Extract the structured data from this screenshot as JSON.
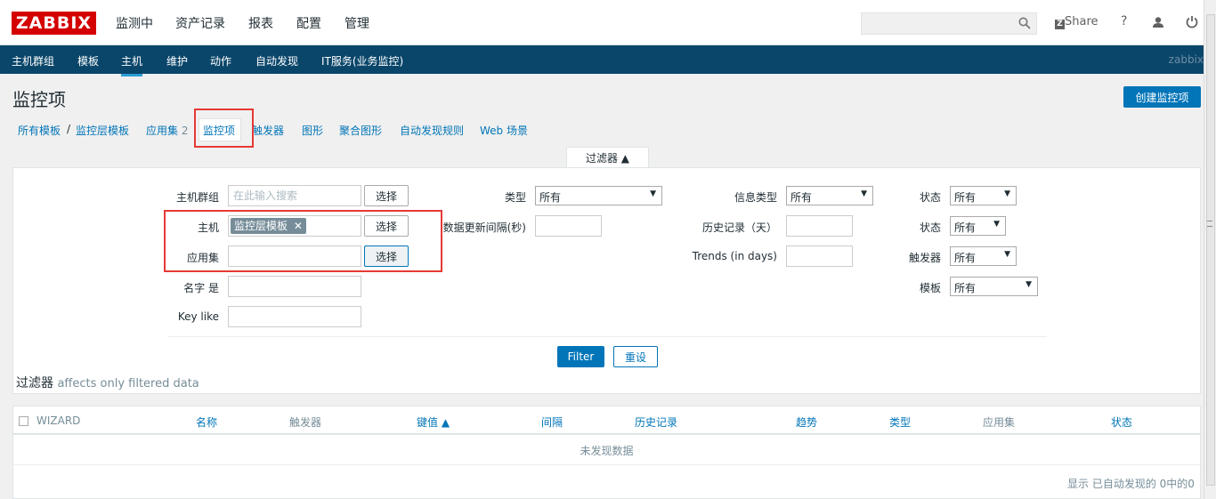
{
  "header": {
    "logo": "ZABBIX",
    "menu": [
      "监测中",
      "资产记录",
      "报表",
      "配置",
      "管理"
    ],
    "search_placeholder": "",
    "share_label": "Share",
    "help_label": "?"
  },
  "subnav": {
    "items": [
      "主机群组",
      "模板",
      "主机",
      "维护",
      "动作",
      "自动发现",
      "IT服务(业务监控)"
    ],
    "right_text": "zabbix"
  },
  "page": {
    "title": "监控项",
    "create_button": "创建监控项"
  },
  "breadcrumbs": {
    "all_templates": "所有模板",
    "separator": "/",
    "template": "监控层模板",
    "apps": "应用集",
    "apps_count": "2",
    "items": "监控项",
    "triggers": "触发器",
    "graphs": "图形",
    "screens": "聚合图形",
    "discovery": "自动发现规则",
    "web": "Web 场景"
  },
  "filter": {
    "tab_label": "过滤器 ▲",
    "host_group_label": "主机群组",
    "host_group_placeholder": "在此输入搜索",
    "select_label": "选择",
    "host_label": "主机",
    "host_tag": "监控层模板",
    "app_label": "应用集",
    "name_label": "名字 是",
    "key_label": "Key like",
    "type_label": "类型",
    "type_value": "所有",
    "interval_label": "数据更新间隔(秒)",
    "info_type_label": "信息类型",
    "info_type_value": "所有",
    "history_label": "历史记录（天）",
    "trends_label": "Trends (in days)",
    "status1_label": "状态",
    "status1_value": "所有",
    "status2_label": "状态",
    "status2_value": "所有",
    "triggers_label": "触发器",
    "triggers_value": "所有",
    "template_label": "模板",
    "template_value": "所有",
    "filter_button": "Filter",
    "reset_button": "重设",
    "note": "过滤器",
    "note_sub": "affects only filtered data"
  },
  "table": {
    "columns": [
      "WIZARD",
      "名称",
      "触发器",
      "键值 ▲",
      "间隔",
      "历史记录",
      "趋势",
      "类型",
      "应用集",
      "状态"
    ],
    "empty": "未发现数据",
    "paging": "显示 已自动发现的 0中的0"
  },
  "colors": {
    "brand_red": "#d40000",
    "nav_bg": "#0a466a",
    "accent_blue": "#0275b8",
    "highlight_red": "#e53935"
  }
}
